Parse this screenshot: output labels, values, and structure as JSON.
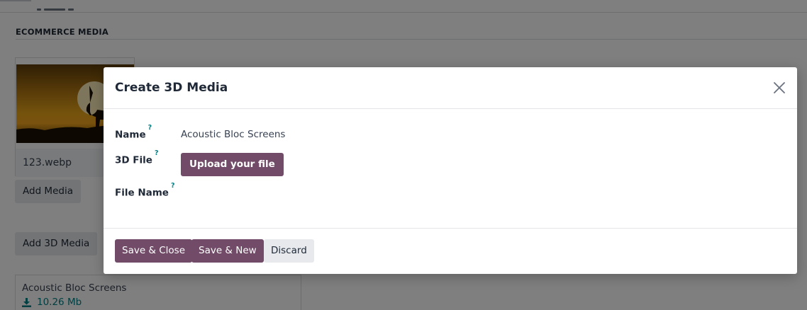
{
  "background": {
    "section_title": "ECOMMERCE MEDIA",
    "media_card": {
      "file_name": "123.webp"
    },
    "add_media_label": "Add Media",
    "add_3d_media_label": "Add 3D Media",
    "file_card": {
      "name": "Acoustic Bloc Screens",
      "size": "10.26 Mb",
      "icon": "download-icon"
    }
  },
  "dialog": {
    "title": "Create 3D Media",
    "close_icon": "close-icon",
    "fields": {
      "name": {
        "label": "Name",
        "help": "?",
        "value": "Acoustic Bloc Screens"
      },
      "file": {
        "label": "3D File",
        "help": "?",
        "upload_label": "Upload your file"
      },
      "file_name": {
        "label": "File Name",
        "help": "?",
        "value": ""
      }
    },
    "footer": {
      "save_close_label": "Save & Close",
      "save_new_label": "Save & New",
      "discard_label": "Discard"
    }
  },
  "colors": {
    "primary": "#714b67",
    "secondary": "#e7e9ed",
    "link": "#017e84",
    "backdrop": "rgba(0,0,0,0.5)"
  }
}
